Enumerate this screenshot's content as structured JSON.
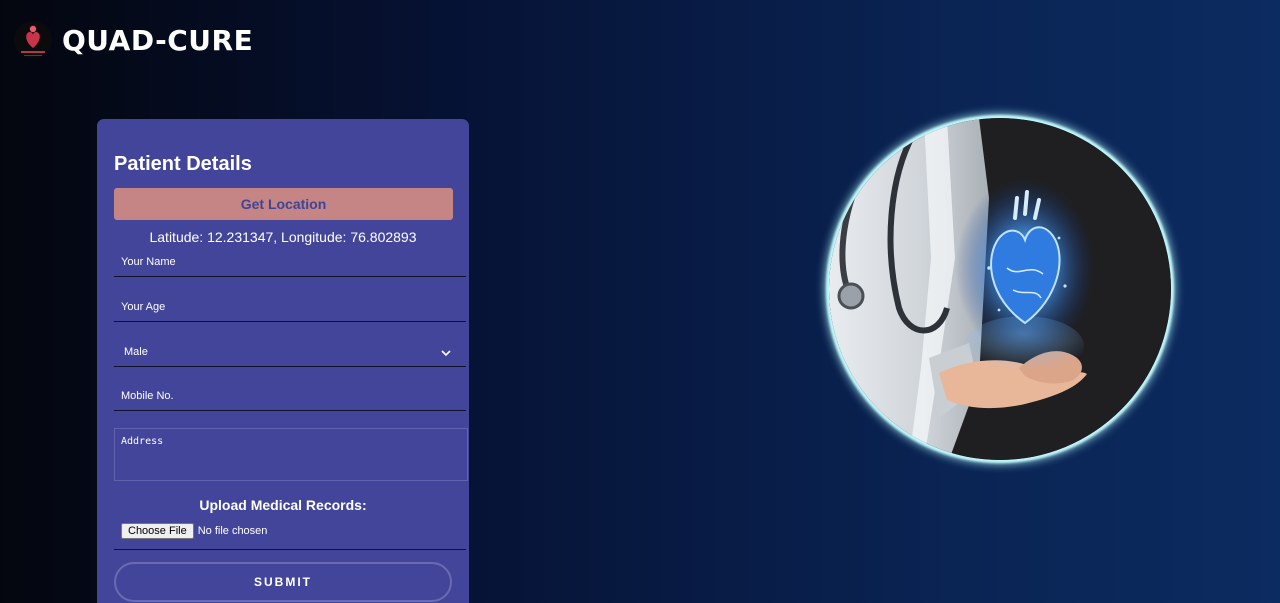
{
  "brand": {
    "title": "QUAD-CURE",
    "logo_icon": "heart-logo-icon"
  },
  "form": {
    "title": "Patient Details",
    "get_location_label": "Get Location",
    "coordinates_text": "Latitude: 12.231347, Longitude: 76.802893",
    "name_placeholder": "Your Name",
    "age_placeholder": "Your Age",
    "gender_selected": "Male",
    "mobile_placeholder": "Mobile No.",
    "address_placeholder": "Address",
    "upload_label": "Upload Medical Records:",
    "choose_file_label": "Choose File",
    "no_file_text": "No file chosen",
    "submit_label": "SUBMIT"
  },
  "hero": {
    "image_subject": "doctor-holding-glowing-heart"
  },
  "colors": {
    "card_bg": "#43459a",
    "location_button": "#c48584",
    "hero_glow": "#aef4f7"
  }
}
